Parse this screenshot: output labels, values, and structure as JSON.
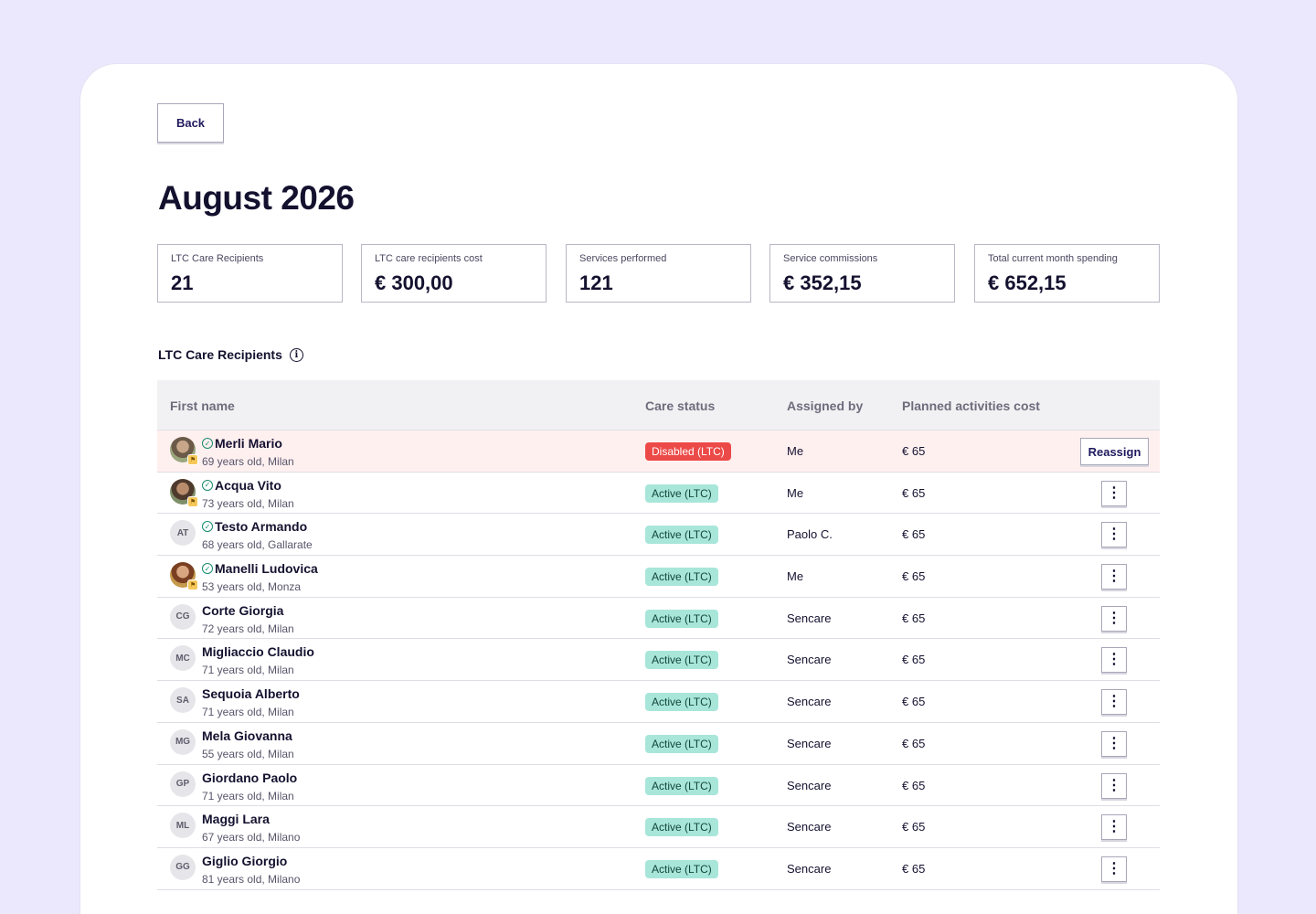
{
  "back_label": "Back",
  "page_title": "August 2026",
  "kpis": [
    {
      "label": "LTC Care Recipients",
      "value": "21"
    },
    {
      "label": "LTC care recipients cost",
      "value": "€ 300,00"
    },
    {
      "label": "Services performed",
      "value": "121"
    },
    {
      "label": "Service commissions",
      "value": "€ 352,15"
    },
    {
      "label": "Total current month spending",
      "value": "€ 652,15"
    }
  ],
  "section_title": "LTC Care Recipients",
  "table": {
    "headers": {
      "first_name": "First name",
      "care_status": "Care status",
      "assigned_by": "Assigned by",
      "cost": "Planned activities cost"
    },
    "reassign_label": "Reassign",
    "rows": [
      {
        "initials": "",
        "photo": "photo",
        "verified": true,
        "name": "Merli Mario",
        "sub": "69 years old, Milan",
        "status": "Disabled (LTC)",
        "status_kind": "disabled",
        "assigned": "Me",
        "cost": "€ 65"
      },
      {
        "initials": "",
        "photo": "photo2",
        "verified": true,
        "name": "Acqua Vito",
        "sub": "73 years old, Milan",
        "status": "Active (LTC)",
        "status_kind": "active",
        "assigned": "Me",
        "cost": "€ 65"
      },
      {
        "initials": "AT",
        "photo": "",
        "verified": true,
        "name": "Testo Armando",
        "sub": "68 years old, Gallarate",
        "status": "Active (LTC)",
        "status_kind": "active",
        "assigned": "Paolo C.",
        "cost": "€ 65"
      },
      {
        "initials": "",
        "photo": "photo3",
        "verified": true,
        "name": "Manelli Ludovica",
        "sub": "53 years old, Monza",
        "status": "Active (LTC)",
        "status_kind": "active",
        "assigned": "Me",
        "cost": "€ 65"
      },
      {
        "initials": "CG",
        "photo": "",
        "verified": false,
        "name": "Corte Giorgia",
        "sub": "72 years old, Milan",
        "status": "Active (LTC)",
        "status_kind": "active",
        "assigned": "Sencare",
        "cost": "€ 65"
      },
      {
        "initials": "MC",
        "photo": "",
        "verified": false,
        "name": "Migliaccio Claudio",
        "sub": "71 years old, Milan",
        "status": "Active (LTC)",
        "status_kind": "active",
        "assigned": "Sencare",
        "cost": "€ 65"
      },
      {
        "initials": "SA",
        "photo": "",
        "verified": false,
        "name": "Sequoia Alberto",
        "sub": "71 years old, Milan",
        "status": "Active (LTC)",
        "status_kind": "active",
        "assigned": "Sencare",
        "cost": "€ 65"
      },
      {
        "initials": "MG",
        "photo": "",
        "verified": false,
        "name": "Mela Giovanna",
        "sub": "55 years old, Milan",
        "status": "Active (LTC)",
        "status_kind": "active",
        "assigned": "Sencare",
        "cost": "€ 65"
      },
      {
        "initials": "GP",
        "photo": "",
        "verified": false,
        "name": "Giordano Paolo",
        "sub": "71 years old, Milan",
        "status": "Active (LTC)",
        "status_kind": "active",
        "assigned": "Sencare",
        "cost": "€ 65"
      },
      {
        "initials": "ML",
        "photo": "",
        "verified": false,
        "name": "Maggi Lara",
        "sub": "67 years old, Milano",
        "status": "Active (LTC)",
        "status_kind": "active",
        "assigned": "Sencare",
        "cost": "€ 65"
      },
      {
        "initials": "GG",
        "photo": "",
        "verified": false,
        "name": "Giglio Giorgio",
        "sub": "81 years old, Milano",
        "status": "Active (LTC)",
        "status_kind": "active",
        "assigned": "Sencare",
        "cost": "€ 65"
      }
    ]
  },
  "colors": {
    "background": "#ebe8fd",
    "active_badge": "#a8e6da",
    "disabled_badge": "#ec4a48",
    "highlight_row": "#fff0f0"
  },
  "icons": {
    "info": "info-icon",
    "verified": "check-circle-icon",
    "more": "more-vertical-icon"
  }
}
